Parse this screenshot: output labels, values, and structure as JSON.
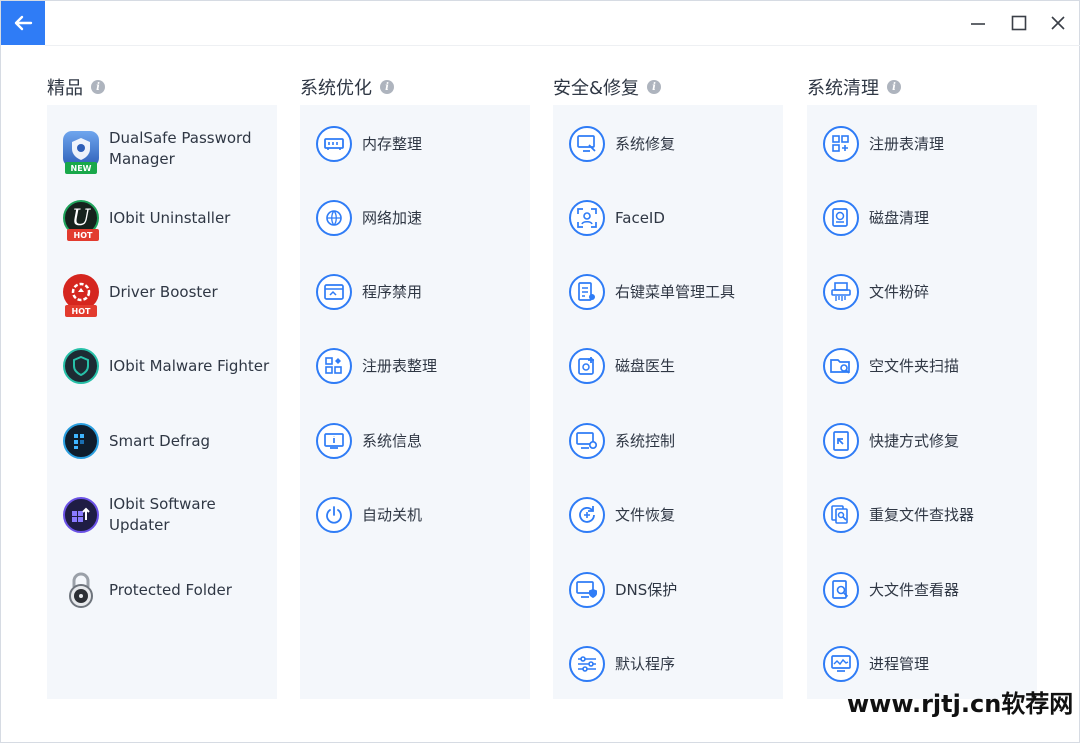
{
  "window": {
    "controls": {
      "minimize": "minimize-icon",
      "maximize": "maximize-icon",
      "close": "close-icon",
      "back": "back-arrow-icon"
    }
  },
  "columns": [
    {
      "title": "精品",
      "items": [
        {
          "label": "DualSafe Password Manager",
          "icon": "dualsafe-icon",
          "badge": "NEW"
        },
        {
          "label": "IObit Uninstaller",
          "icon": "uninstaller-icon",
          "badge": "HOT"
        },
        {
          "label": "Driver Booster",
          "icon": "driver-booster-icon",
          "badge": "HOT"
        },
        {
          "label": "IObit Malware Fighter",
          "icon": "malware-fighter-icon",
          "badge": ""
        },
        {
          "label": "Smart Defrag",
          "icon": "smart-defrag-icon",
          "badge": ""
        },
        {
          "label": "IObit Software Updater",
          "icon": "software-updater-icon",
          "badge": ""
        },
        {
          "label": "Protected Folder",
          "icon": "padlock-icon",
          "badge": ""
        }
      ]
    },
    {
      "title": "系统优化",
      "items": [
        {
          "label": "内存整理",
          "icon": "memory-icon"
        },
        {
          "label": "网络加速",
          "icon": "network-rocket-icon"
        },
        {
          "label": "程序禁用",
          "icon": "window-program-icon"
        },
        {
          "label": "注册表整理",
          "icon": "registry-grid-icon"
        },
        {
          "label": "系统信息",
          "icon": "system-info-icon"
        },
        {
          "label": "自动关机",
          "icon": "power-icon"
        }
      ]
    },
    {
      "title": "安全&修复",
      "items": [
        {
          "label": "系统修复",
          "icon": "monitor-wrench-icon"
        },
        {
          "label": "FaceID",
          "icon": "face-id-icon"
        },
        {
          "label": "右键菜单管理工具",
          "icon": "context-menu-icon"
        },
        {
          "label": "磁盘医生",
          "icon": "disk-doctor-icon"
        },
        {
          "label": "系统控制",
          "icon": "monitor-gear-icon"
        },
        {
          "label": "文件恢复",
          "icon": "file-recovery-icon"
        },
        {
          "label": "DNS保护",
          "icon": "dns-shield-icon"
        },
        {
          "label": "默认程序",
          "icon": "sliders-icon"
        }
      ]
    },
    {
      "title": "系统清理",
      "items": [
        {
          "label": "注册表清理",
          "icon": "registry-clean-icon"
        },
        {
          "label": "磁盘清理",
          "icon": "disk-clean-icon"
        },
        {
          "label": "文件粉碎",
          "icon": "shredder-icon"
        },
        {
          "label": "空文件夹扫描",
          "icon": "empty-folder-scan-icon"
        },
        {
          "label": "快捷方式修复",
          "icon": "shortcut-fix-icon"
        },
        {
          "label": "重复文件查找器",
          "icon": "duplicate-finder-icon"
        },
        {
          "label": "大文件查看器",
          "icon": "large-file-icon"
        },
        {
          "label": "进程管理",
          "icon": "process-monitor-icon"
        }
      ]
    }
  ],
  "watermark": "www.rjtj.cn软荐网",
  "colors": {
    "accent": "#2f7cf6",
    "panel": "#f4f7fb",
    "text": "#2f3744",
    "badge_new": "#19a84a",
    "badge_hot": "#e23b2e"
  }
}
